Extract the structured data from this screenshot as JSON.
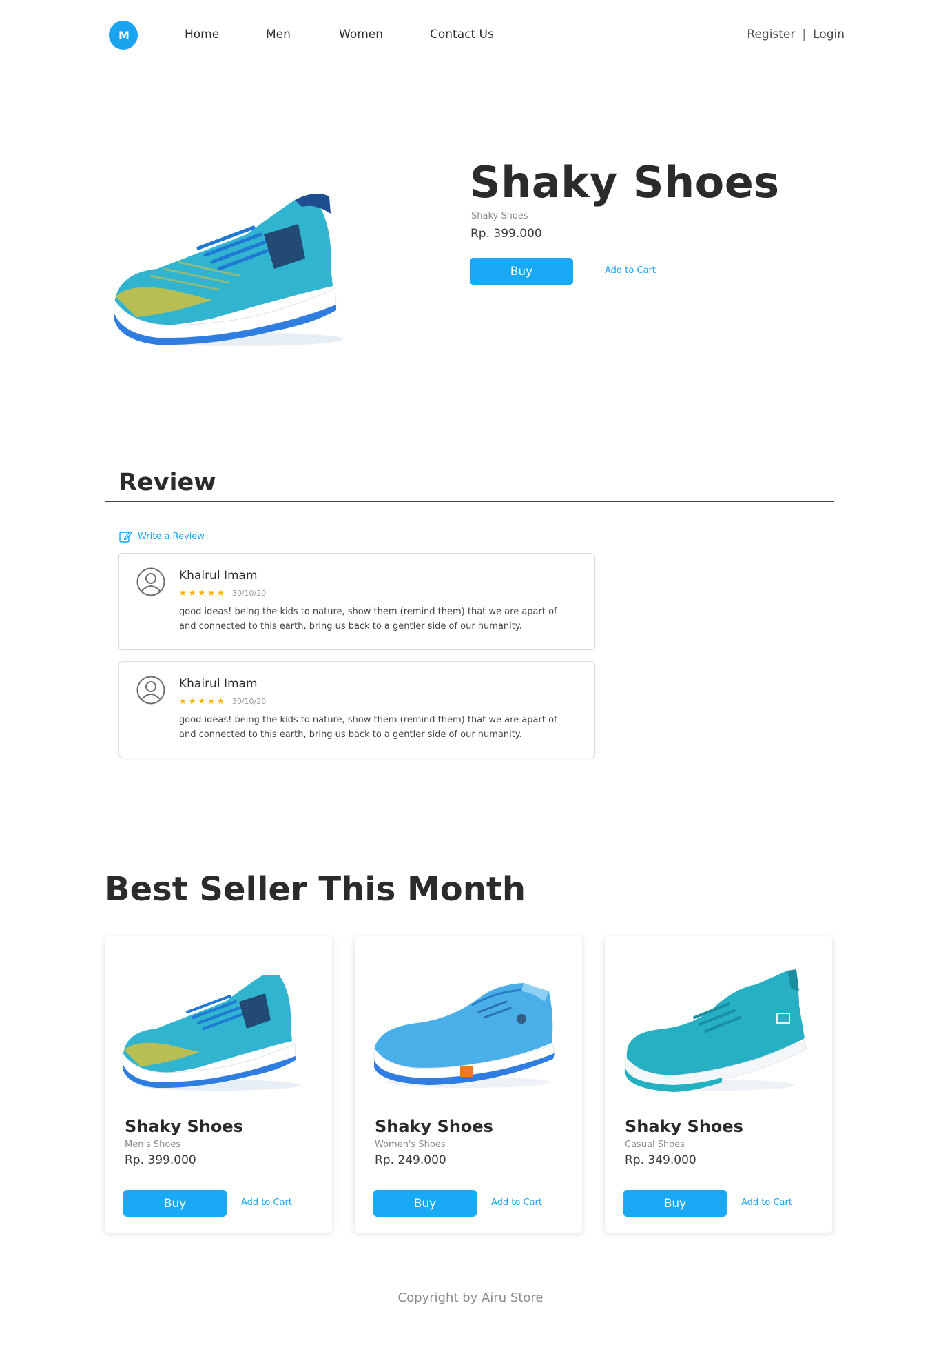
{
  "nav": {
    "logo_text": "M",
    "links": [
      "Home",
      "Men",
      "Women",
      "Contact Us"
    ],
    "register": "Register",
    "separator": "|",
    "login": "Login"
  },
  "hero": {
    "title": "Shaky Shoes",
    "subtitle": "Shaky Shoes",
    "price": "Rp. 399.000",
    "buy_label": "Buy",
    "cart_label": "Add to Cart"
  },
  "review": {
    "title": "Review",
    "write_label": "Write a Review",
    "items": [
      {
        "name": "Khairul Imam",
        "rating": 5,
        "date": "30/10/20",
        "text": "good ideas! being the kids to nature, show them (remind them) that we are apart of and connected to this earth, bring us back to a gentler side of our humanity."
      },
      {
        "name": "Khairul Imam",
        "rating": 5,
        "date": "30/10/20",
        "text": "good ideas! being the kids to nature, show them (remind them) that we are apart of and connected to this earth, bring us back to a gentler side of our humanity."
      }
    ]
  },
  "best": {
    "title": "Best Seller This Month",
    "products": [
      {
        "name": "Shaky Shoes",
        "category": "Men's Shoes",
        "price": "Rp. 399.000",
        "buy_label": "Buy",
        "cart_label": "Add to Cart"
      },
      {
        "name": "Shaky Shoes",
        "category": "Women's Shoes",
        "price": "Rp. 249.000",
        "buy_label": "Buy",
        "cart_label": "Add to Cart"
      },
      {
        "name": "Shaky Shoes",
        "category": "Casual Shoes",
        "price": "Rp. 349.000",
        "buy_label": "Buy",
        "cart_label": "Add to Cart"
      }
    ]
  },
  "footer": {
    "copyright": "Copyright by Airu Store"
  },
  "colors": {
    "accent": "#1aa9f5",
    "star": "#f5b400",
    "text": "#2b2b2b"
  }
}
